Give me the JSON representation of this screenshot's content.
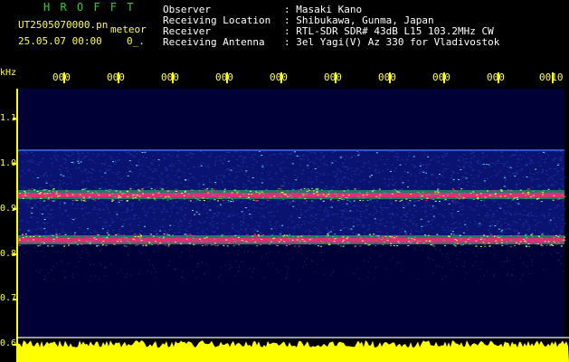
{
  "header": {
    "program_name": "H R O F F T",
    "file_name": "UT2505070000.pn",
    "meteor_label": "meteor",
    "datetime": "25.05.07 00:00",
    "count_label": "0_.",
    "info_labels": [
      "Observer",
      "Receiving Location",
      "Receiver",
      "Receiving Antenna"
    ],
    "info_values": [
      ": Masaki Kano",
      ": Shibukawa, Gunma, Japan",
      ": RTL-SDR SDR# 43dB L15 103.2MHz CW",
      ": 3el Yagi(V) Az 330 for Vladivostok"
    ]
  },
  "chart_data": {
    "type": "heatmap",
    "y_unit": "kHz",
    "y_ticks": [
      "1.1",
      "1.0",
      "0.9",
      "0.8",
      "0.7",
      "0.6"
    ],
    "x_ticks": [
      "000",
      "000",
      "000",
      "000",
      "000",
      "000",
      "000",
      "000",
      "000",
      "0010"
    ],
    "bands_khz": [
      0.83,
      0.93
    ],
    "signal_range_khz": [
      0.82,
      1.03
    ],
    "colors": {
      "background": "#000036",
      "noise": "#2233aa",
      "mid": "#33cc66",
      "peak": "#ff2277",
      "bottom_trace": "#ffff00"
    }
  }
}
